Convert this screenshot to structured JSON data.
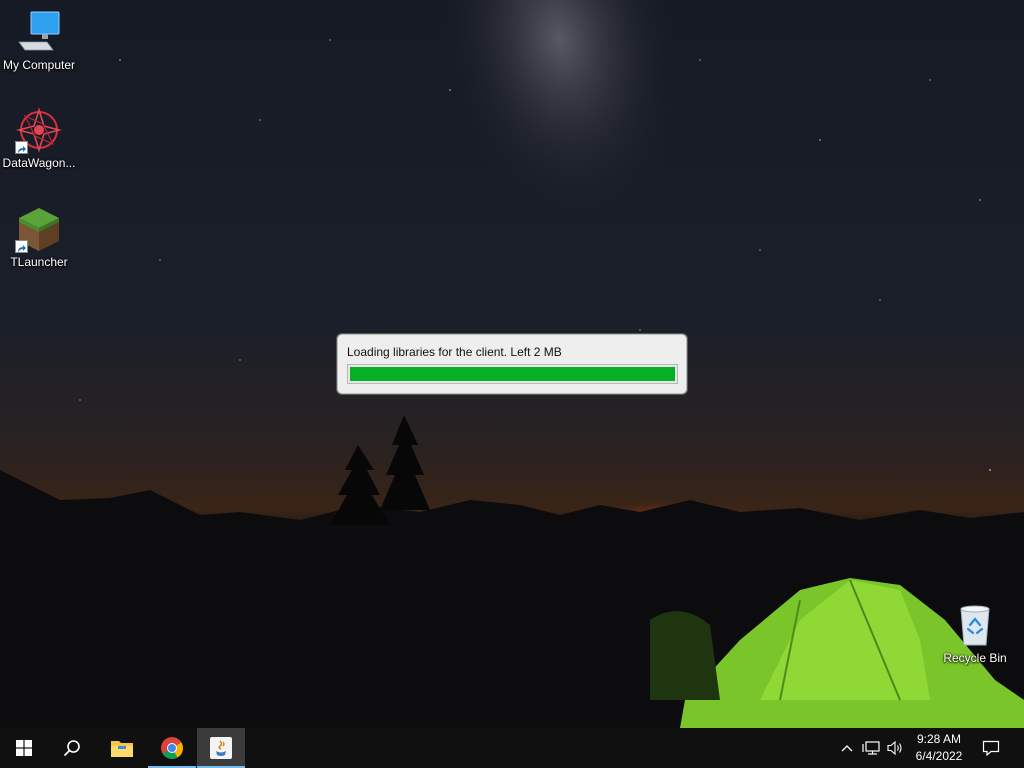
{
  "desktop": {
    "icons": [
      {
        "label": "My Computer",
        "icon": "computer-icon"
      },
      {
        "label": "DataWagon...",
        "icon": "datawagon-icon",
        "shortcut": true
      },
      {
        "label": "TLauncher",
        "icon": "grass-block-icon",
        "shortcut": true
      },
      {
        "label": "Recycle Bin",
        "icon": "recycle-bin-icon"
      }
    ]
  },
  "loader": {
    "message": "Loading libraries for the client. Left 2 MB",
    "progress_percent": 100,
    "bar_color": "#06b025"
  },
  "taskbar": {
    "items": [
      {
        "icon": "windows-start-icon"
      },
      {
        "icon": "search-icon"
      },
      {
        "icon": "file-explorer-icon"
      },
      {
        "icon": "chrome-icon",
        "running": true
      },
      {
        "icon": "java-icon",
        "active": true
      }
    ],
    "tray": [
      "chevron-up-icon",
      "network-icon",
      "volume-icon",
      "notifications-icon"
    ],
    "clock": {
      "time": "9:28 AM",
      "date": "6/4/2022"
    },
    "accent": "#76b9ed"
  }
}
